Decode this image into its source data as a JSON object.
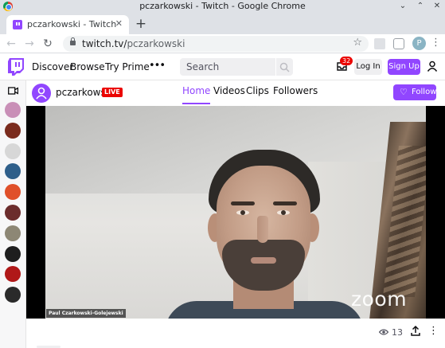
{
  "window": {
    "title": "pczarkowski - Twitch - Google Chrome"
  },
  "browser": {
    "tab_title": "pczarkowski - Twitch",
    "url_host": "twitch.tv/",
    "url_path": "pczarkowski",
    "profile_initial": "P"
  },
  "twitch_nav": {
    "links": [
      "Discover",
      "Browse",
      "Try Prime"
    ],
    "search_placeholder": "Search",
    "inbox_badge": "32",
    "login_label": "Log In",
    "signup_label": "Sign Up"
  },
  "sidebar": {
    "channels": [
      {
        "color": "#c98fb7"
      },
      {
        "color": "#7a2b1d"
      },
      {
        "color": "#d7d7d7"
      },
      {
        "color": "#2f5f8a"
      },
      {
        "color": "#e0502a"
      },
      {
        "color": "#6b2c2c"
      },
      {
        "color": "#8d8775"
      },
      {
        "color": "#1e1e1e"
      },
      {
        "color": "#b01818"
      },
      {
        "color": "#2a2a2a"
      }
    ]
  },
  "channel": {
    "name": "pczarkowski",
    "live_label": "LIVE",
    "tabs": [
      {
        "label": "Home",
        "active": true
      },
      {
        "label": "Videos",
        "active": false
      },
      {
        "label": "Clips",
        "active": false
      },
      {
        "label": "Followers",
        "active": false
      }
    ],
    "follow_label": "Follow"
  },
  "video": {
    "participant_name": "Paul Czarkowski-Golejewski",
    "watermark": "zoom"
  },
  "actions": {
    "viewer_count": "13"
  },
  "colors": {
    "twitch_purple": "#9146ff",
    "live_red": "#eb0400"
  }
}
